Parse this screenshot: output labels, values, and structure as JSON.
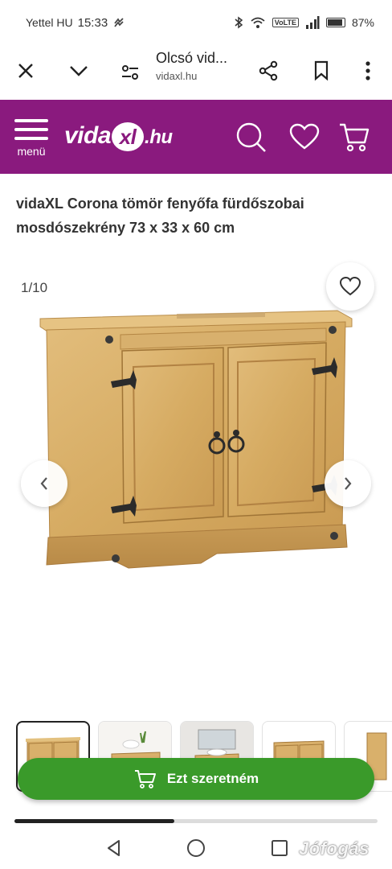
{
  "status_bar": {
    "carrier": "Yettel HU",
    "time": "15:33",
    "network": "VoLTE",
    "battery": "87%"
  },
  "browser": {
    "tab_title": "Olcsó vid...",
    "domain": "vidaxl.hu",
    "icons": [
      "close-icon",
      "chevron-down-icon",
      "site-settings-icon",
      "share-icon",
      "bookmark-icon",
      "more-icon"
    ]
  },
  "site_header": {
    "menu_label": "menü",
    "logo_left": "vida",
    "logo_mark": "xl",
    "logo_right": ".hu",
    "background": "#8a1a7e",
    "icons": [
      "hamburger-icon",
      "search-icon",
      "heart-icon",
      "cart-icon"
    ]
  },
  "product": {
    "title": "vidaXL Corona tömör fenyőfa fürdőszobai mosdószekrény 73 x 33 x 60 cm",
    "image_counter": "1/10"
  },
  "gallery": {
    "current_index": 1,
    "total": 10,
    "thumbnail_count": 5
  },
  "cta": {
    "label": "Ezt szeretném",
    "color": "#3a9a2a"
  },
  "scroll_progress": 0.44,
  "watermark": "Jófogás"
}
